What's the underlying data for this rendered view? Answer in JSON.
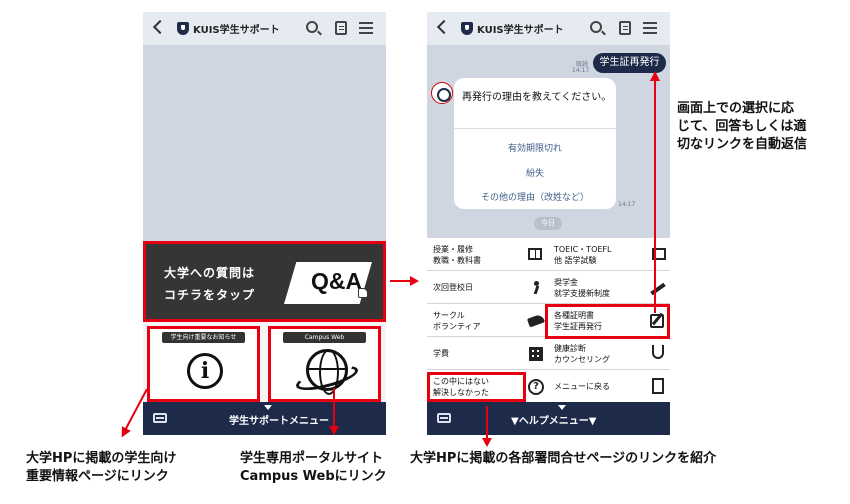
{
  "colors": {
    "accent_red": "#e60012",
    "navy": "#1d2a4a",
    "chat_bg": "#cfd6e1",
    "link_blue": "#3e5f8a"
  },
  "phone1": {
    "header": {
      "title": "KUIS学生サポート",
      "icons": [
        "back-icon",
        "shield-icon",
        "search-icon",
        "note-icon",
        "menu-icon"
      ]
    },
    "banner": {
      "line1": "大学への質問は",
      "line2": "コチラをタップ",
      "badge": "Q&A"
    },
    "tiles": [
      {
        "caption": "学生向け重要なお知らせ",
        "icon": "info-icon"
      },
      {
        "caption": "Campus Web",
        "icon": "globe-icon"
      }
    ],
    "bottom_bar": {
      "label": "学生サポートメニュー"
    }
  },
  "phone2": {
    "header": {
      "title": "KUIS学生サポート"
    },
    "chat": {
      "user_message": {
        "read": "既読",
        "time": "14:17",
        "text": "学生証再発行"
      },
      "bot_message": {
        "question": "再発行の理由を教えてください。",
        "options": [
          "有効期限切れ",
          "紛失",
          "その他の理由（改姓など）"
        ],
        "time": "14:17"
      },
      "date_pill": "今日"
    },
    "menu_items": [
      {
        "label": "授業・履修\n教職・教科書",
        "icon": "book-icon"
      },
      {
        "label": "TOEIC・TOEFL\n他 語学試験",
        "icon": "signboard-icon"
      },
      {
        "label": "次回登校日",
        "icon": "walking-person-icon"
      },
      {
        "label": "奨学金\n就学支援新制度",
        "icon": "pencil-icon"
      },
      {
        "label": "サークル\nボランティア",
        "icon": "shoe-icon"
      },
      {
        "label": "各種証明書\n学生証再発行",
        "icon": "document-pen-icon"
      },
      {
        "label": "学費",
        "icon": "building-icon"
      },
      {
        "label": "健康診断\nカウンセリング",
        "icon": "stethoscope-icon"
      },
      {
        "label": "この中にはない\n解決しなかった",
        "icon": "question-icon"
      },
      {
        "label": "メニューに戻る",
        "icon": "exit-door-icon"
      }
    ],
    "bottom_bar": {
      "label": "▼ヘルプメニュー▼"
    }
  },
  "annotations": {
    "right": "画面上での選択に応\nじて、回答もしくは適\n切なリンクを自動返信",
    "bottom_left": "大学HPに掲載の学生向け\n重要情報ページにリンク",
    "bottom_middle": "学生専用ポータルサイト\nCampus Webにリンク",
    "bottom_right": "大学HPに掲載の各部署問合せページのリンクを紹介"
  }
}
